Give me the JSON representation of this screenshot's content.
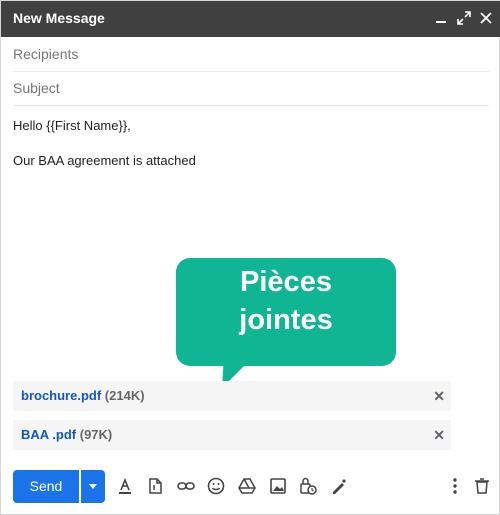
{
  "window": {
    "title": "New Message"
  },
  "fields": {
    "recipients_placeholder": "Recipients",
    "subject_placeholder": "Subject"
  },
  "body": {
    "line1": "Hello {{First Name}},",
    "line2": "Our BAA agreement is attached"
  },
  "callout": {
    "line1": "Pièces",
    "line2": "jointes"
  },
  "attachments": [
    {
      "name": "brochure.pdf",
      "size": "(214K)"
    },
    {
      "name": "BAA .pdf",
      "size": "(97K)"
    }
  ],
  "toolbar": {
    "send_label": "Send"
  },
  "icons": [
    "minimize-icon",
    "pop-out-icon",
    "close-icon",
    "dropdown-arrow-icon",
    "text-format-icon",
    "attach-file-icon",
    "insert-link-icon",
    "emoji-icon",
    "google-drive-icon",
    "insert-photo-icon",
    "confidential-mode-icon",
    "signature-icon",
    "more-options-icon",
    "discard-draft-icon"
  ],
  "colors": {
    "titlebar": "#404040",
    "send": "#1a73e8",
    "callout": "#10b594",
    "attachment_link": "#1155cc"
  }
}
